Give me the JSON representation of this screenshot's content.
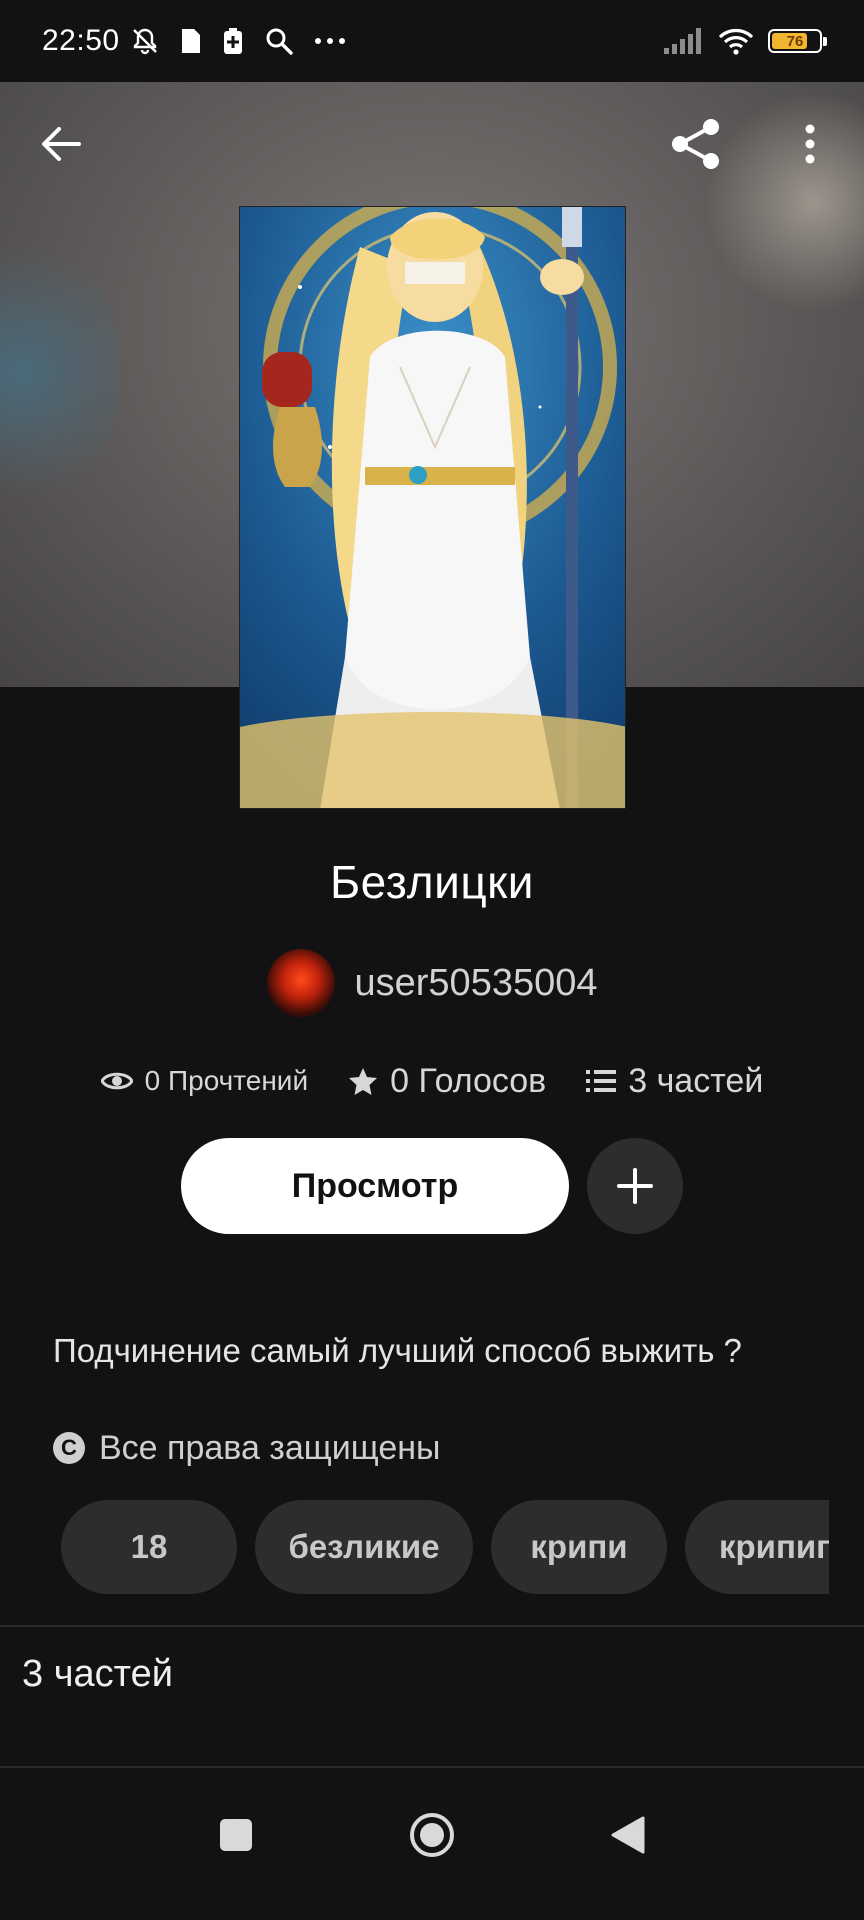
{
  "status_bar": {
    "time": "22:50",
    "battery_level": "76",
    "battery_fraction": 0.76,
    "battery_color": "#f2b531"
  },
  "header": {
    "back_icon": "arrow-left-icon",
    "share_icon": "share-icon",
    "more_icon": "more-vertical-icon"
  },
  "story": {
    "title": "Безлицки",
    "author": "user50535004",
    "reads": "0 Прочтений",
    "votes": "0 Голосов",
    "parts": "3 частей",
    "description": "Подчинение самый лучший способ выжить ?",
    "rights": "Все права защищены",
    "tags": [
      "18",
      "безликие",
      "крипи",
      "крипип"
    ]
  },
  "actions": {
    "view_label": "Просмотр",
    "add_icon": "plus-icon"
  },
  "parts_section": {
    "title": "3 частей"
  },
  "nav_bar": {
    "recents_icon": "square-icon",
    "home_icon": "circle-home-icon",
    "back_icon": "triangle-back-icon"
  },
  "colors": {
    "background": "#121114",
    "chip": "#2d2c2f",
    "battery": "#f2b531"
  }
}
